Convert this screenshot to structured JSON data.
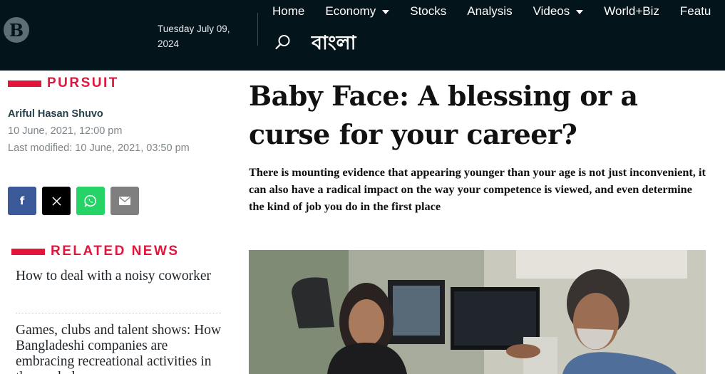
{
  "header": {
    "logo_letter": "B",
    "date_line1": "Tuesday July 09,",
    "date_line2": "2024",
    "nav": [
      {
        "label": "Home",
        "dropdown": false
      },
      {
        "label": "Economy",
        "dropdown": true
      },
      {
        "label": "Stocks",
        "dropdown": false
      },
      {
        "label": "Analysis",
        "dropdown": false
      },
      {
        "label": "Videos",
        "dropdown": true
      },
      {
        "label": "World+Biz",
        "dropdown": false
      },
      {
        "label": "Featu",
        "dropdown": false
      }
    ],
    "language_link": "বাংলা",
    "search_icon": "search-icon",
    "background": "#04141b"
  },
  "sidebar": {
    "section": "PURSUIT",
    "author": "Ariful Hasan Shuvo",
    "published": "10 June, 2021, 12:00 pm",
    "modified": "Last modified: 10 June, 2021, 03:50 pm",
    "share": [
      {
        "icon": "facebook-icon",
        "glyph": "f",
        "color": "#3b5998"
      },
      {
        "icon": "x-icon",
        "glyph": "𝕏",
        "color": "#000000"
      },
      {
        "icon": "whatsapp-icon",
        "glyph": "",
        "color": "#25d366"
      },
      {
        "icon": "email-icon",
        "glyph": "",
        "color": "#7f7f7f"
      }
    ],
    "related_title": "RELATED NEWS",
    "related": [
      "How to deal with a noisy coworker",
      "Games, clubs and talent shows: How Bangladeshi companies are embracing recreational activities in the workplace"
    ],
    "accent": "#e0163c"
  },
  "article": {
    "headline": "Baby Face: A blessing or a curse for your career?",
    "intro": "There is mounting evidence that appearing younger than your age is not just inconvenient, it can also have a radical impact on the way your competence is viewed, and even determine the kind of job you do in the first place"
  }
}
